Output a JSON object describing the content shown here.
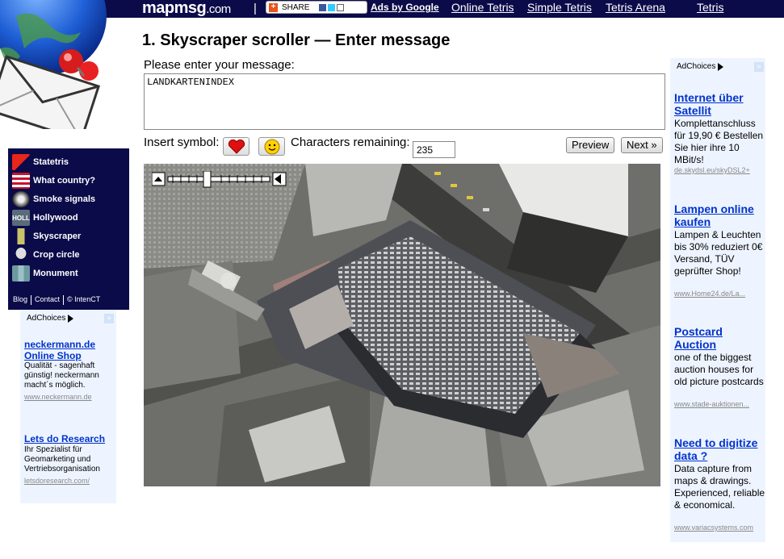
{
  "topbar": {
    "brand": "mapmsg",
    "brand_domain": ".com",
    "separator": "|",
    "share_label": "SHARE",
    "links": [
      "Ads by Google",
      "Online Tetris",
      "Simple Tetris",
      "Tetris Arena",
      "Tetris"
    ]
  },
  "nav": {
    "items": [
      {
        "label": "Statetris",
        "icon": "statetris-icon"
      },
      {
        "label": "What country?",
        "icon": "us-flag-icon"
      },
      {
        "label": "Smoke signals",
        "icon": "smoke-icon"
      },
      {
        "label": "Hollywood",
        "icon": "hollywood-sign-icon"
      },
      {
        "label": "Skyscraper",
        "icon": "skyscraper-icon"
      },
      {
        "label": "Crop circle",
        "icon": "alien-icon"
      },
      {
        "label": "Monument",
        "icon": "statue-of-liberty-icon"
      }
    ],
    "footer": {
      "blog": "Blog",
      "contact": "Contact",
      "copyright": "© IntenCT"
    }
  },
  "left_ads": {
    "adchoices": "AdChoices",
    "ads": [
      {
        "title": "neckermann.de Online Shop",
        "body": "Qualität - sagenhaft günstig! neckermann macht´s möglich.",
        "url": "www.neckermann.de"
      },
      {
        "title": "Lets do Research",
        "body": "Ihr Spezialist für Geomarketing und Vertriebsorganisation",
        "url": "letsdoresearch.com/"
      }
    ]
  },
  "main": {
    "heading": "1. Skyscraper scroller — Enter message",
    "message_label": "Please enter your message:",
    "message_value": "LANDKARTENINDEX",
    "insert_symbol_label": "Insert symbol:",
    "chars_label": "Characters remaining:",
    "chars_value": "235",
    "preview_label": "Preview",
    "next_label": "Next »"
  },
  "right_ads": {
    "adchoices": "AdChoices",
    "ads": [
      {
        "title": "Internet über Satellit",
        "body": "Komplettanschluss für 19,90 € Bestellen Sie hier ihre 10 MBit/s!",
        "url": "de.skydsl.eu/skyDSL2+"
      },
      {
        "title": "Lampen online kaufen",
        "body": "Lampen & Leuchten bis 30% reduziert 0€ Versand, TÜV geprüfter Shop!",
        "url": "www.Home24.de/La..."
      },
      {
        "title": "Postcard Auction",
        "body": "one of the biggest auction houses for old picture postcards",
        "url": "www.stade-auktionen..."
      },
      {
        "title": "Need to digitize data ?",
        "body": "Data capture from maps & drawings. Experienced, reliable & economical.",
        "url": "www.variacsystems.com"
      }
    ]
  },
  "colors": {
    "navy": "#0b0b4a",
    "link_blue": "#0033cc",
    "ad_bg": "#eef4ff"
  }
}
